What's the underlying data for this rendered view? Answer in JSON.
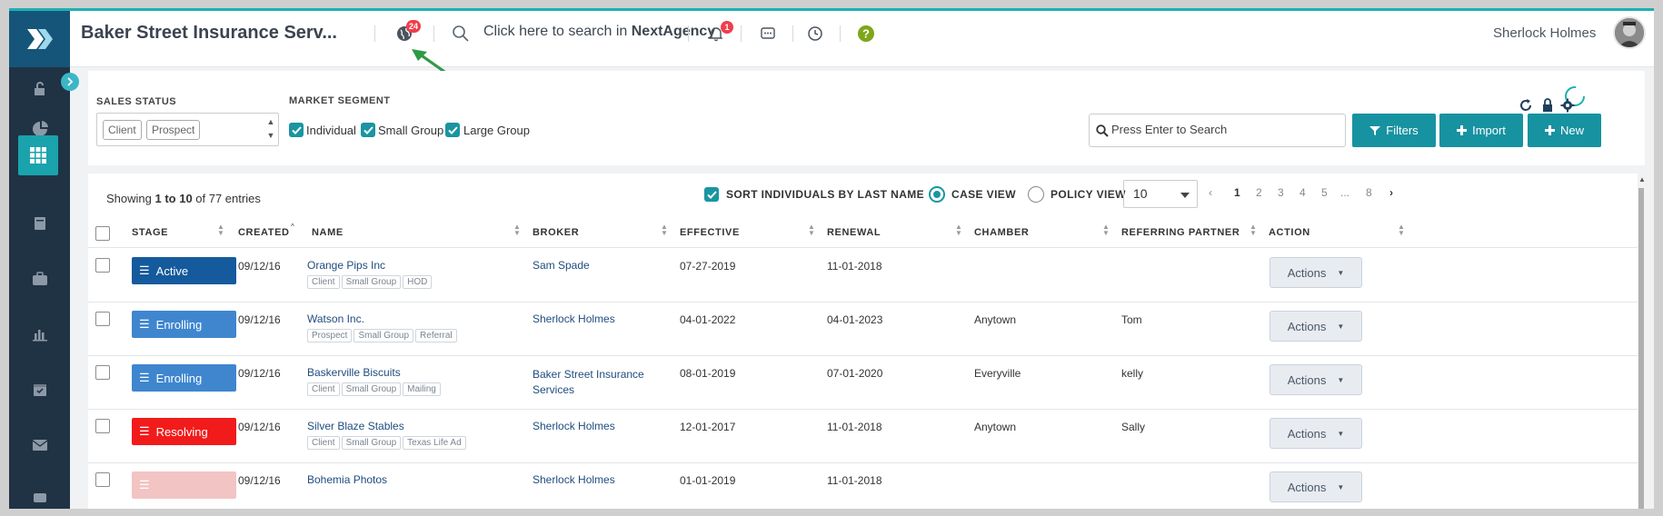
{
  "header": {
    "title": "Baker Street Insurance Serv...",
    "globe_badge": "24",
    "search_prefix": "Click here to search in ",
    "search_brand": "NextAgency",
    "notifications_badge": "1",
    "user_name": "Sherlock Holmes"
  },
  "filters": {
    "sales_status_label": "SALES STATUS",
    "sales_status_tags": [
      "Client",
      "Prospect"
    ],
    "market_segment_label": "MARKET SEGMENT",
    "segments": [
      "Individual",
      "Small Group",
      "Large Group"
    ],
    "search_placeholder": "Press Enter to Search",
    "filters_btn": "Filters",
    "import_btn": "Import",
    "new_btn": "New"
  },
  "table": {
    "showing_prefix": "Showing ",
    "showing_range": "1 to 10",
    "showing_suffix": " of 77 entries",
    "sort_by_last_name": "SORT INDIVIDUALS BY LAST NAME",
    "case_view": "CASE VIEW",
    "policy_view": "POLICY VIEW",
    "page_size": "10",
    "pages": [
      "1",
      "2",
      "3",
      "4",
      "5",
      "...",
      "8"
    ],
    "columns": [
      "STAGE",
      "CREATED",
      "NAME",
      "BROKER",
      "EFFECTIVE",
      "RENEWAL",
      "CHAMBER",
      "REFERRING PARTNER",
      "ACTION"
    ],
    "rows": [
      {
        "stage": "Active",
        "stage_color": "#145a9c",
        "created": "09/12/16",
        "name": "Orange Pips Inc",
        "tags": [
          "Client",
          "Small Group",
          "HOD"
        ],
        "broker": "Sam Spade",
        "broker2": "",
        "effective": "07-27-2019",
        "renewal": "11-01-2018",
        "chamber": "",
        "partner": "",
        "action": "Actions"
      },
      {
        "stage": "Enrolling",
        "stage_color": "#3f86cf",
        "created": "09/12/16",
        "name": "Watson Inc.",
        "tags": [
          "Prospect",
          "Small Group",
          "Referral"
        ],
        "broker": "Sherlock Holmes",
        "broker2": "",
        "effective": "04-01-2022",
        "renewal": "04-01-2023",
        "chamber": "Anytown",
        "partner": "Tom",
        "action": "Actions"
      },
      {
        "stage": "Enrolling",
        "stage_color": "#3f86cf",
        "created": "09/12/16",
        "name": "Baskerville Biscuits",
        "tags": [
          "Client",
          "Small Group",
          "Mailing"
        ],
        "broker": "Baker Street Insurance",
        "broker2": "Services",
        "effective": "08-01-2019",
        "renewal": "07-01-2020",
        "chamber": "Everyville",
        "partner": "kelly",
        "action": "Actions"
      },
      {
        "stage": "Resolving",
        "stage_color": "#f21b1b",
        "created": "09/12/16",
        "name": "Silver Blaze Stables",
        "tags": [
          "Client",
          "Small Group",
          "Texas Life Ad"
        ],
        "broker": "Sherlock Holmes",
        "broker2": "",
        "effective": "12-01-2017",
        "renewal": "11-01-2018",
        "chamber": "Anytown",
        "partner": "Sally",
        "action": "Actions"
      },
      {
        "stage": "",
        "stage_color": "#f2c4c4",
        "created": "09/12/16",
        "name": "Bohemia Photos",
        "tags": [],
        "broker": "Sherlock Holmes",
        "broker2": "",
        "effective": "01-01-2019",
        "renewal": "11-01-2018",
        "chamber": "",
        "partner": "",
        "action": "Actions"
      }
    ]
  },
  "colors": {
    "accent": "#1792a1",
    "sidebar": "#1f3345",
    "active_stage": "#145a9c",
    "enrolling_stage": "#3f86cf",
    "resolving_stage": "#f21b1b",
    "annotation_arrow": "#2e9a44"
  }
}
